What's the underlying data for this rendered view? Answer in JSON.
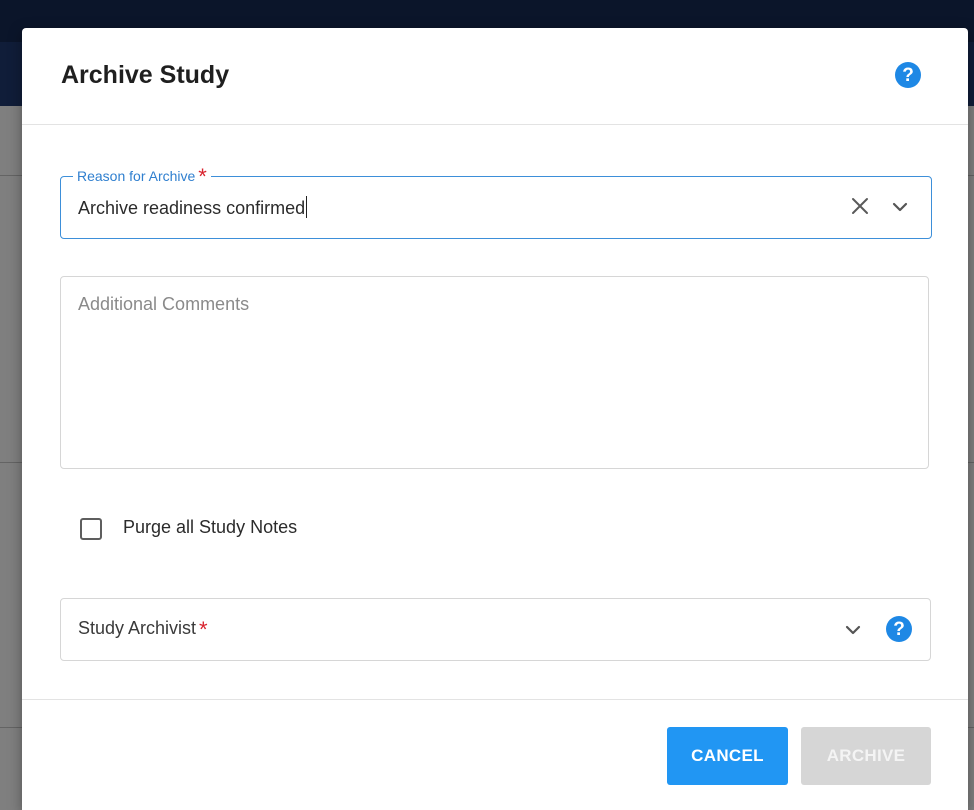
{
  "dialog": {
    "title": "Archive Study",
    "help_icon": "question-circle-icon"
  },
  "reason_field": {
    "label": "Reason for Archive",
    "required_marker": "*",
    "value": "Archive readiness confirmed",
    "clear_icon": "close-icon",
    "expand_icon": "chevron-down-icon"
  },
  "comments_field": {
    "placeholder": "Additional Comments",
    "value": ""
  },
  "purge_checkbox": {
    "label": "Purge all Study Notes",
    "checked": false
  },
  "archivist_field": {
    "label": "Study Archivist",
    "required_marker": "*",
    "expand_icon": "chevron-down-icon",
    "help_icon": "question-circle-icon"
  },
  "footer": {
    "cancel_label": "CANCEL",
    "archive_label": "ARCHIVE",
    "archive_disabled": true
  },
  "colors": {
    "accent": "#2196f3",
    "required": "#d9232e",
    "disabled": "#d6d6d6"
  }
}
